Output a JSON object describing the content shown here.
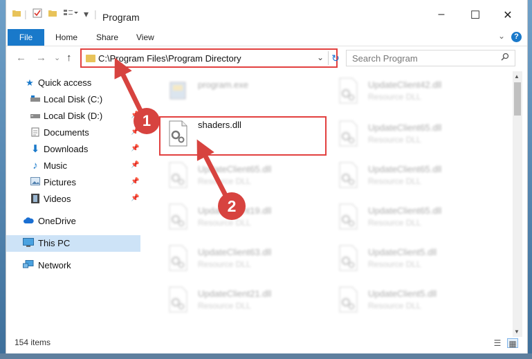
{
  "titlebar": {
    "title": "Program",
    "minimize": "–",
    "maximize": "☐",
    "close": "✕"
  },
  "ribbon": {
    "tabs": [
      "File",
      "Home",
      "Share",
      "View"
    ],
    "help": "?"
  },
  "navigation": {
    "back": "←",
    "forward": "→",
    "recent": "⌄",
    "up": "↑",
    "address": "C:\\Program Files\\Program Directory",
    "refresh": "↻",
    "search_placeholder": "Search Program"
  },
  "sidebar": {
    "items": [
      {
        "label": "Quick access",
        "icon": "star-icon"
      },
      {
        "label": "Local Disk (C:)",
        "icon": "drive-icon"
      },
      {
        "label": "Local Disk (D:)",
        "icon": "drive-icon"
      },
      {
        "label": "Documents",
        "icon": "documents-icon"
      },
      {
        "label": "Downloads",
        "icon": "download-icon"
      },
      {
        "label": "Music",
        "icon": "music-icon"
      },
      {
        "label": "Pictures",
        "icon": "pictures-icon"
      },
      {
        "label": "Videos",
        "icon": "videos-icon"
      },
      {
        "label": "OneDrive",
        "icon": "cloud-icon"
      },
      {
        "label": "This PC",
        "icon": "computer-icon"
      },
      {
        "label": "Network",
        "icon": "network-icon"
      }
    ]
  },
  "files": [
    {
      "name": "program.exe",
      "type": ""
    },
    {
      "name": "UpdateClient42.dll",
      "type": "Resource DLL"
    },
    {
      "name": "shaders.dll",
      "type": ""
    },
    {
      "name": "UpdateClient65.dll",
      "type": "Resource DLL"
    },
    {
      "name": "UpdateClient65.dll",
      "type": "Resource DLL"
    },
    {
      "name": "UpdateClient65.dll",
      "type": "Resource DLL"
    },
    {
      "name": "UpdateClient19.dll",
      "type": "Resource DLL"
    },
    {
      "name": "UpdateClient65.dll",
      "type": "Resource DLL"
    },
    {
      "name": "UpdateClient63.dll",
      "type": "Resource DLL"
    },
    {
      "name": "UpdateClient5.dll",
      "type": "Resource DLL"
    },
    {
      "name": "UpdateClient21.dll",
      "type": "Resource DLL"
    },
    {
      "name": "UpdateClient5.dll",
      "type": "Resource DLL"
    }
  ],
  "status": {
    "item_count": "154 items"
  },
  "callouts": [
    "1",
    "2"
  ],
  "colors": {
    "accent": "#1979ca",
    "highlight": "#e2403f",
    "callout": "#d7433f",
    "selected": "#cde3f7"
  }
}
